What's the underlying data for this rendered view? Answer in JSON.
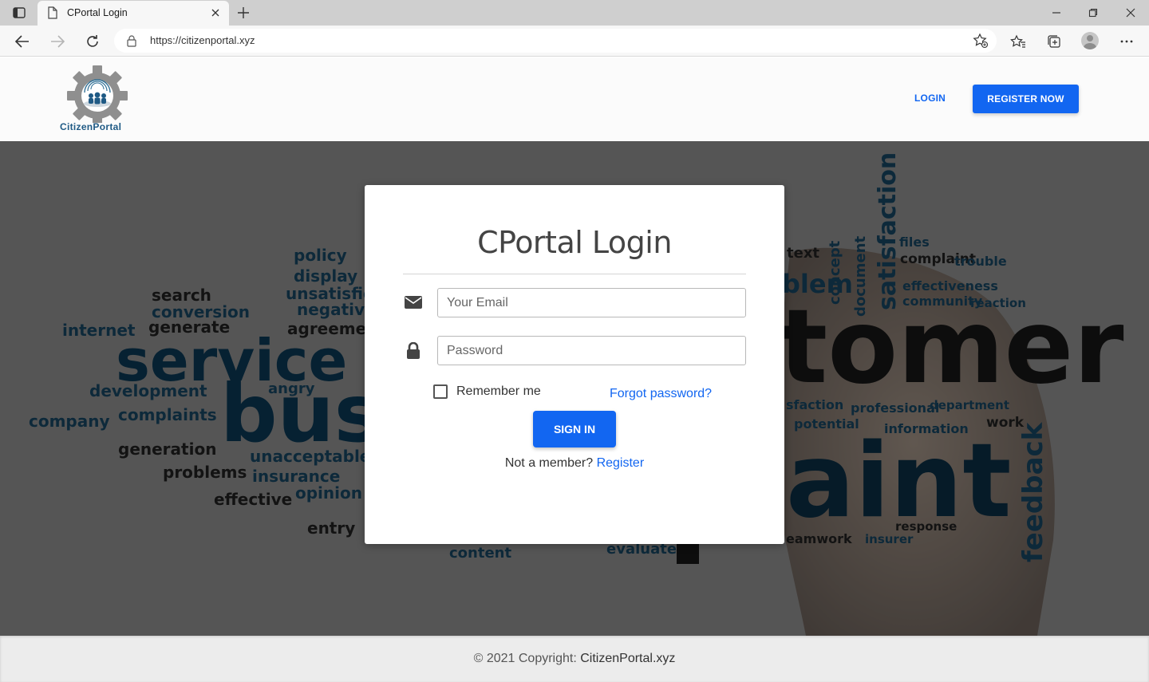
{
  "browser": {
    "tab_title": "CPortal Login",
    "url": "https://citizenportal.xyz"
  },
  "header": {
    "logo_text": "CitizenPortal",
    "login_label": "LOGIN",
    "register_label": "REGISTER NOW"
  },
  "hero": {
    "words": [
      "policy",
      "display",
      "search",
      "unsatisfie",
      "conversion",
      "negative",
      "internet",
      "generate",
      "agreemen",
      "service",
      "development",
      "angry",
      "company",
      "complaints",
      "bus",
      "generation",
      "unacceptable",
      "problems",
      "insurance",
      "effective",
      "opinion",
      "entry",
      "content",
      "evaluate",
      "text",
      "files",
      "complaint",
      "trouble",
      "blem",
      "concept",
      "document",
      "satisfaction",
      "effectiveness",
      "community",
      "reaction",
      "tomer",
      "sfaction",
      "professional",
      "department",
      "potential",
      "information",
      "work",
      "aint",
      "feedback",
      "response",
      "eamwork",
      "insurer"
    ]
  },
  "login": {
    "title": "CPortal Login",
    "email_placeholder": "Your Email",
    "password_placeholder": "Password",
    "remember_label": "Remember me",
    "forgot_label": "Forgot password?",
    "signin_label": "SIGN IN",
    "not_member": "Not a member?",
    "register_link": "Register"
  },
  "footer": {
    "copyright": "© 2021 Copyright:",
    "brand": "CitizenPortal.xyz"
  }
}
